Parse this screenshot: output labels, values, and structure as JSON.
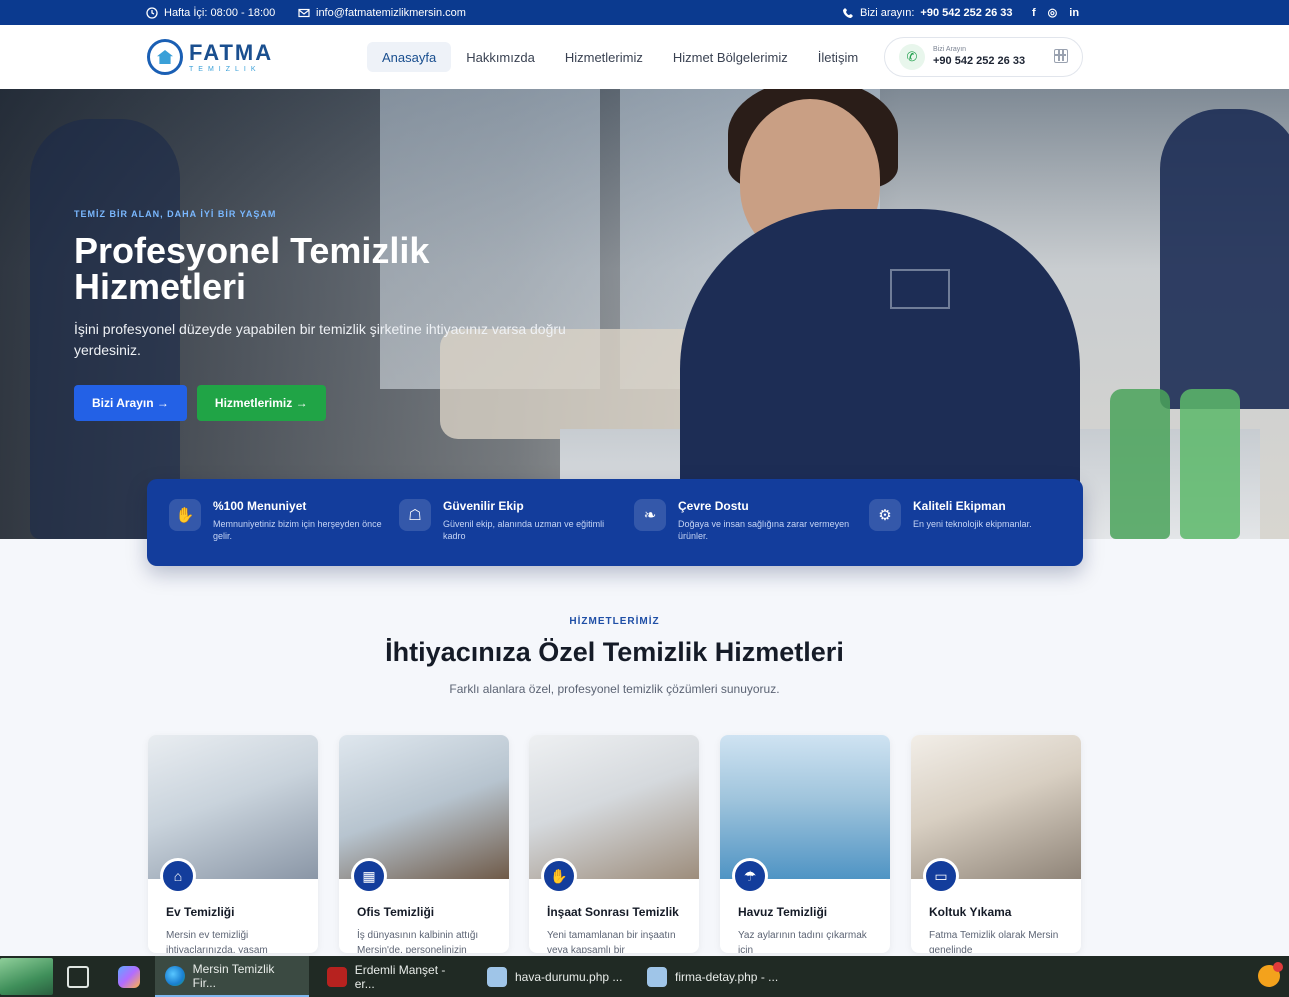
{
  "topbar": {
    "hours": "Hafta İçi: 08:00 - 18:00",
    "email": "info@fatmatemizlikmersin.com",
    "call_label": "Bizi arayın:",
    "call_number": "+90 542 252 26 33",
    "social_icons": [
      "facebook-icon",
      "instagram-icon",
      "linkedin-icon"
    ]
  },
  "header": {
    "logo_name": "FATMA",
    "logo_sub": "TEMIZLIK",
    "nav": [
      {
        "label": "Anasayfa",
        "active": true
      },
      {
        "label": "Hakkımızda"
      },
      {
        "label": "Hizmetlerimiz"
      },
      {
        "label": "Hizmet Bölgelerimiz"
      },
      {
        "label": "İletişim"
      }
    ],
    "call_box": {
      "label": "Bizi Arayın",
      "number": "+90 542 252 26 33"
    }
  },
  "hero": {
    "eyebrow": "TEMİZ BİR ALAN, DAHA İYİ BİR YAŞAM",
    "title_line1": "Profesyonel Temizlik",
    "title_line2": "Hizmetleri",
    "description": "İşini profesyonel düzeyde yapabilen bir temizlik şirketine ihtiyacınız varsa doğru yerdesiniz.",
    "btn_primary": "Bizi Arayın →",
    "btn_secondary": "Hizmetlerimiz →"
  },
  "features": [
    {
      "title": "%100 Menuniyet",
      "desc": "Memnuniyetiniz bizim için herşeyden önce gelir.",
      "icon": "clean-hand-icon"
    },
    {
      "title": "Güvenilir Ekip",
      "desc": "Güvenil ekip, alanında uzman ve eğitimli kadro",
      "icon": "team-icon"
    },
    {
      "title": "Çevre Dostu",
      "desc": "Doğaya ve insan sağlığına zarar vermeyen ürünler.",
      "icon": "leaf-icon"
    },
    {
      "title": "Kaliteli Ekipman",
      "desc": "En yeni teknolojik ekipmanlar.",
      "icon": "equipment-icon"
    }
  ],
  "services": {
    "label": "HİZMETLERİMİZ",
    "title": "İhtiyacınıza Özel Temizlik Hizmetleri",
    "subtitle": "Farklı alanlara özel, profesyonel temizlik çözümleri sunuyoruz.",
    "cards": [
      {
        "title": "Ev Temizliği",
        "desc": "Mersin ev temizliği ihtiyaçlarınızda, yaşam",
        "icon": "home-icon"
      },
      {
        "title": "Ofis Temizliği",
        "desc": "İş dünyasının kalbinin attığı Mersin'de, personelinizin",
        "icon": "building-icon"
      },
      {
        "title": "İnşaat Sonrası Temizlik",
        "desc": "Yeni tamamlanan bir inşaatın veya kapsamlı bir",
        "icon": "clean-hand-icon"
      },
      {
        "title": "Havuz Temizliği",
        "desc": "Yaz aylarının tadını çıkarmak için",
        "icon": "shower-icon"
      },
      {
        "title": "Koltuk Yıkama",
        "desc": "Fatma Temizlik olarak Mersin genelinde",
        "icon": "sofa-icon"
      }
    ]
  },
  "taskbar": {
    "apps": [
      {
        "label": "Mersin Temizlik Fir...",
        "active": true
      },
      {
        "label": "Erdemli Manşet - er..."
      },
      {
        "label": "hava-durumu.php ..."
      },
      {
        "label": "firma-detay.php - ..."
      }
    ]
  },
  "colors": {
    "topbar": "#0b3a8f",
    "brand_blue": "#133d9c",
    "btn_blue": "#2361e6",
    "btn_green": "#20a446"
  }
}
